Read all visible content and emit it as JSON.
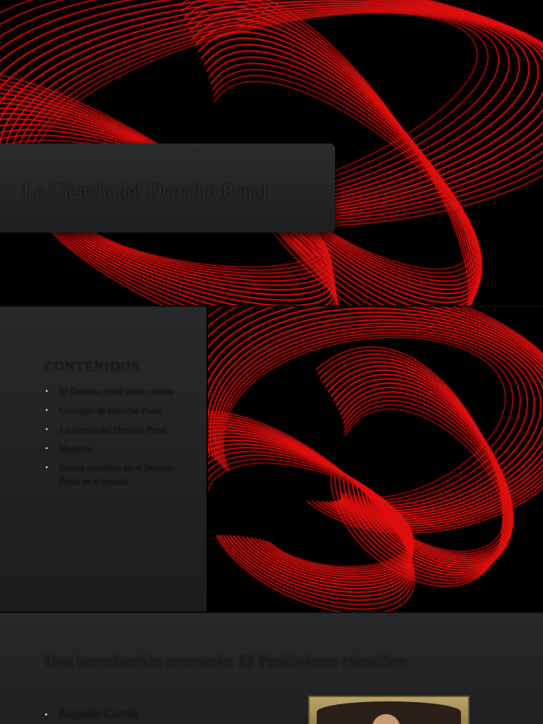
{
  "slide1": {
    "title": "La Ciencia del Derecho Penal"
  },
  "slide2": {
    "heading": "CONTENIDOS",
    "items": [
      "El Derecho penal como ciencia",
      "Concepto de Derecho Penal",
      "La ciencia del Derecho Penal",
      "Modelos",
      "Interés científico en el Derecho Penal en el mundo"
    ]
  },
  "slide3": {
    "title": "Una introducción necesaria: El Positivismo científico",
    "bullets": [
      "Augusto Comte"
    ]
  },
  "colors": {
    "ribbon_red": "#e01010",
    "background_black": "#000000",
    "panel_gray": "#252628"
  },
  "icons": {
    "bullet": "•"
  }
}
